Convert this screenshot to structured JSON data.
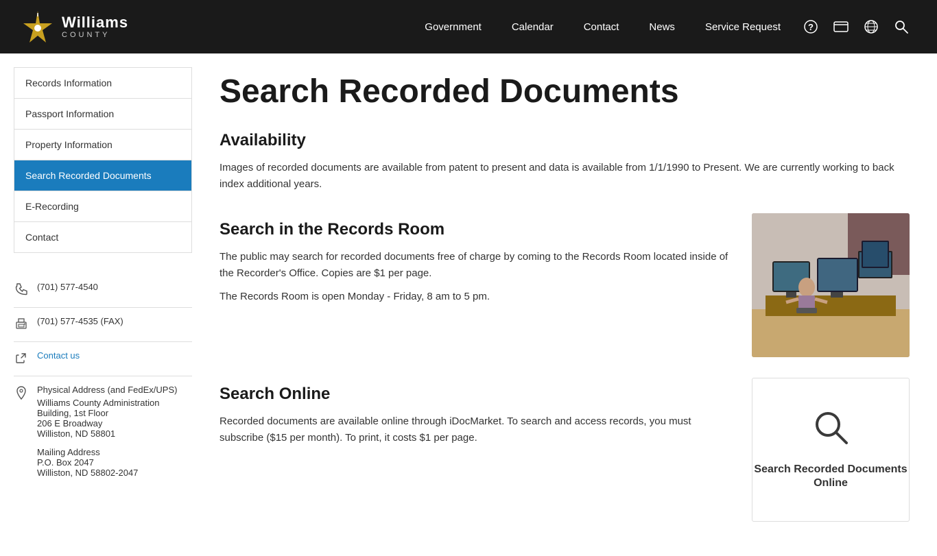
{
  "header": {
    "logo": {
      "williams": "Williams",
      "county": "COUNTY"
    },
    "nav": {
      "items": [
        {
          "label": "Government",
          "href": "#"
        },
        {
          "label": "Calendar",
          "href": "#"
        },
        {
          "label": "Contact",
          "href": "#"
        },
        {
          "label": "News",
          "href": "#"
        },
        {
          "label": "Service Request",
          "href": "#"
        }
      ]
    },
    "icons": {
      "help": "?",
      "card": "▬",
      "globe": "🌐",
      "search": "🔍"
    }
  },
  "sidebar": {
    "menu": [
      {
        "label": "Records Information",
        "active": false
      },
      {
        "label": "Passport Information",
        "active": false
      },
      {
        "label": "Property Information",
        "active": false
      },
      {
        "label": "Search Recorded Documents",
        "active": true
      },
      {
        "label": "E-Recording",
        "active": false
      },
      {
        "label": "Contact",
        "active": false
      }
    ],
    "contact": {
      "phone": "(701) 577-4540",
      "fax": "(701) 577-4535 (FAX)",
      "contact_us": "Contact us",
      "physical_label": "Physical Address (and FedEx/UPS)",
      "physical_lines": [
        "Williams County Administration Building, 1st Floor",
        "206 E Broadway",
        "Williston, ND 58801"
      ],
      "mailing_label": "Mailing Address",
      "mailing_lines": [
        "P.O. Box 2047",
        "Williston, ND 58802-2047"
      ]
    }
  },
  "main": {
    "title": "Search Recorded Documents",
    "availability": {
      "heading": "Availability",
      "text": "Images of recorded documents are available from patent to present and data is available from 1/1/1990 to Present. We are currently working to back index additional years."
    },
    "records_room": {
      "heading": "Search in the Records Room",
      "text1": "The public may search for recorded documents free of charge by coming to the Records Room located inside of the Recorder's Office. Copies are $1 per page.",
      "text2": "The Records Room is open Monday - Friday, 8 am to 5 pm."
    },
    "search_online": {
      "heading": "Search Online",
      "text": "Recorded documents are available online through iDocMarket. To search and access records, you must subscribe ($15 per month). To print, it costs $1 per page.",
      "card_label": "Search Recorded Documents Online"
    }
  }
}
